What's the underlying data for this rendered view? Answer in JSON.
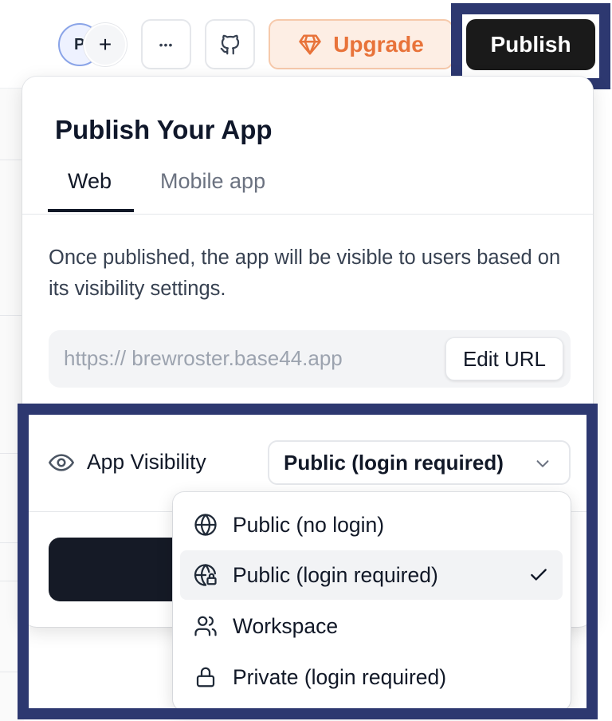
{
  "toolbar": {
    "avatar_initial": "P",
    "add_collaborator": "+",
    "more_label": "•••",
    "upgrade_label": "Upgrade",
    "publish_label": "Publish"
  },
  "panel": {
    "title": "Publish Your App",
    "tabs": [
      {
        "label": "Web",
        "active": true
      },
      {
        "label": "Mobile app",
        "active": false
      }
    ],
    "description": "Once published, the app will be visible to users based on its visibility settings.",
    "url": {
      "value": "https:// brewroster.base44.app",
      "edit_label": "Edit URL"
    },
    "visibility": {
      "label": "App Visibility",
      "selected": "Public (login required)",
      "options": [
        {
          "label": "Public (no login)",
          "icon": "globe-icon",
          "checked": false
        },
        {
          "label": "Public (login required)",
          "icon": "globe-lock-icon",
          "checked": true
        },
        {
          "label": "Workspace",
          "icon": "users-icon",
          "checked": false
        },
        {
          "label": "Private (login required)",
          "icon": "lock-icon",
          "checked": false
        }
      ]
    }
  },
  "colors": {
    "accent_upgrade": "#e8733a",
    "publish_bg": "#1a1a1a",
    "highlight_frame": "#2d3870"
  }
}
